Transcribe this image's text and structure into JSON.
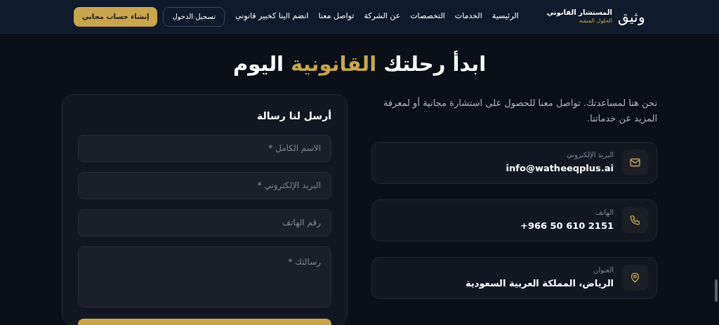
{
  "header": {
    "logo_mark": "وثيق",
    "brand_title": "المستشار القانوني",
    "brand_subtitle": "الحلول المتقنة",
    "nav": [
      {
        "label": "الرئيسية",
        "selected": false
      },
      {
        "label": "الخدمات",
        "selected": false
      },
      {
        "label": "التخصصات",
        "selected": false
      },
      {
        "label": "عن الشركة",
        "selected": false
      },
      {
        "label": "تواصل معنا",
        "selected": false
      },
      {
        "label": "انضم الينا كخبير قانوني",
        "selected": false
      }
    ],
    "login_button": "تسجيل الدخول",
    "signup_button": "إنشاء حساب مجاني"
  },
  "heading": {
    "before": "ابدأ رحلتك",
    "highlight": "القانونية",
    "after": "اليوم"
  },
  "intro": "نحن هنا لمساعدتك. تواصل معنا للحصول على استشارة مجانية أو لمعرفة المزيد عن خدماتنا.",
  "contacts": [
    {
      "kind": "email",
      "label": "البريد الإلكتروني",
      "value": "info@watheeqplus.ai"
    },
    {
      "kind": "phone",
      "label": "الهاتف",
      "value": "+966 50 610 2151"
    },
    {
      "kind": "location",
      "label": "العنوان",
      "value": "الرياض، المملكة العربية السعودية"
    }
  ],
  "form": {
    "title": "أرسل لنا رسالة",
    "fields": [
      {
        "kind": "input",
        "placeholder": "الاسم الكامل *"
      },
      {
        "kind": "input",
        "placeholder": "البريد الإلكتروني *"
      },
      {
        "kind": "input",
        "placeholder": "رقم الهاتف"
      },
      {
        "kind": "textarea",
        "placeholder": "رسالتك *"
      }
    ]
  }
}
